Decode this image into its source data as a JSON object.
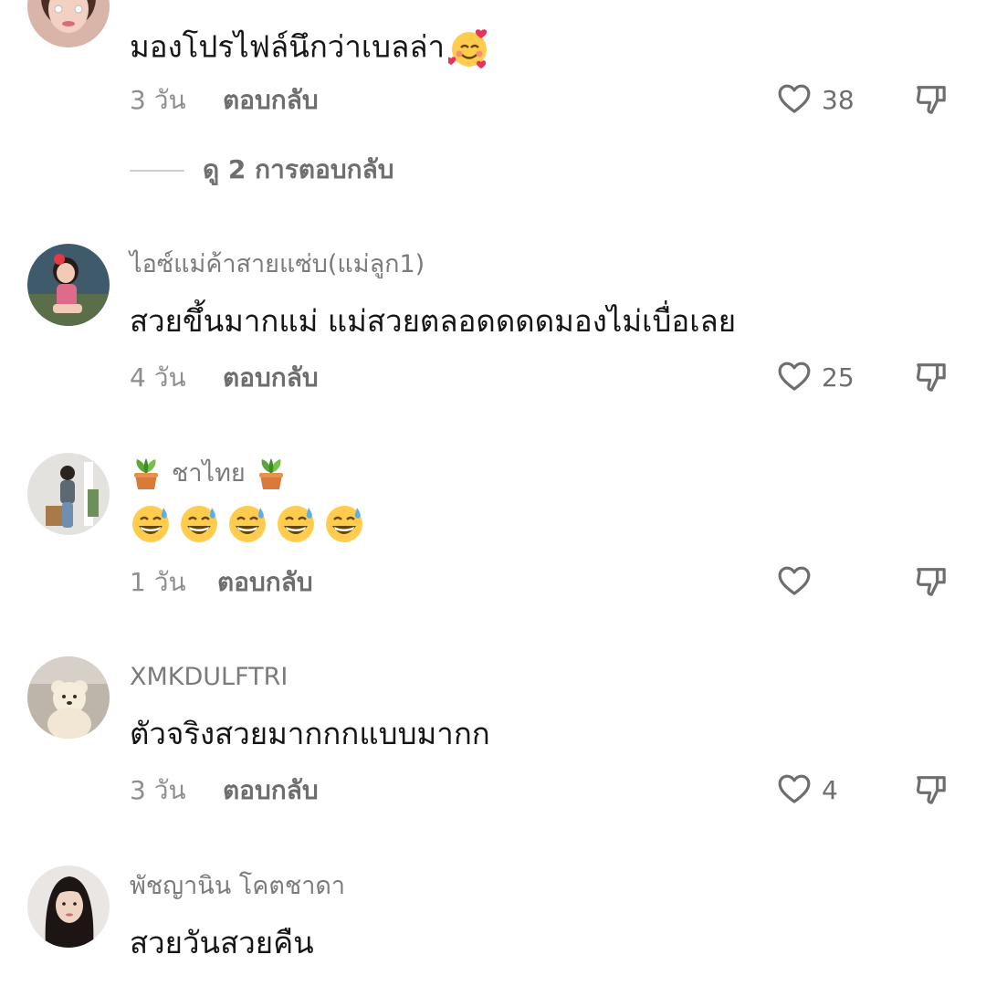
{
  "comments": [
    {
      "text": "มองโปรไฟล์นึกว่าเบลล่า",
      "text_emoji": "smiling-face-with-hearts",
      "time": "3 วัน",
      "reply_label": "ตอบกลับ",
      "likes": "38",
      "view_replies": "ดู 2 การตอบกลับ"
    },
    {
      "username": "ไอซ์แม่ค้าสายแซ่บ(แม่ลูก1)",
      "text": "สวยขึ้นมากแม่ แม่สวยตลอดดดดมองไม่เบื่อเลย",
      "time": "4 วัน",
      "reply_label": "ตอบกลับ",
      "likes": "25"
    },
    {
      "username": "ชาไทย",
      "username_emoji": "potted-plant",
      "text_emoji": "grinning-face-with-sweat",
      "text_emoji_count": 5,
      "time": "1 วัน",
      "reply_label": "ตอบกลับ",
      "likes": ""
    },
    {
      "username": "XMKDULFTRI",
      "text": "ตัวจริงสวยมากกกแบบมากก",
      "time": "3 วัน",
      "reply_label": "ตอบกลับ",
      "likes": "4"
    },
    {
      "username": "พัชญานิน โคตชาดา",
      "text": "สวยวันสวยคืน"
    }
  ],
  "colors": {
    "username": "#7b7b7b",
    "text": "#161616",
    "meta": "#8e8e8e",
    "icon": "#6e6e6e",
    "divider": "#cfcfcf"
  },
  "icons": {
    "like": "heart-outline-icon",
    "dislike": "thumbs-down-outline-icon"
  }
}
